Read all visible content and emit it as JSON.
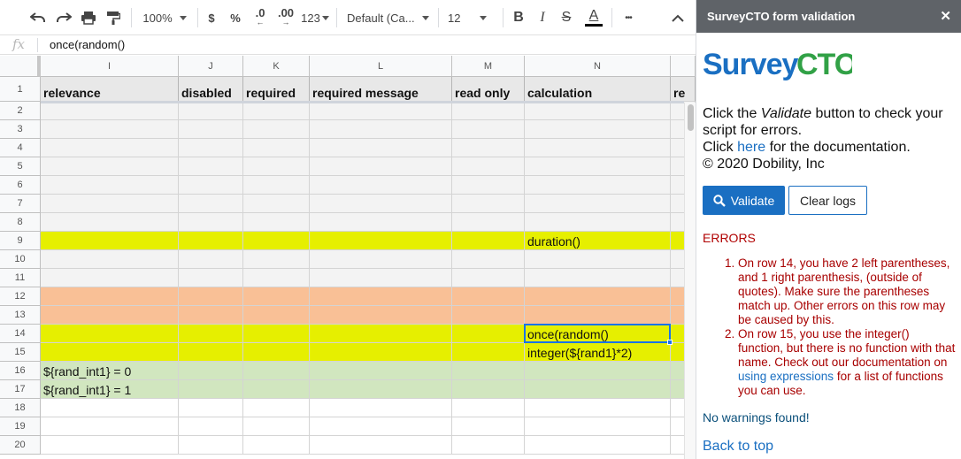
{
  "toolbar": {
    "zoom": "100%",
    "currency": "$",
    "percent": "%",
    "decrease_decimal": ".0",
    "increase_decimal": ".00",
    "number_format": "123",
    "font": "Default (Ca...",
    "font_size": "12",
    "bold": "B",
    "italic": "I",
    "strikethrough": "S",
    "text_color": "A",
    "more": "•••"
  },
  "formula_bar": {
    "fx": "fx",
    "value": "once(random()"
  },
  "columns": [
    {
      "letter": "I",
      "header": "relevance"
    },
    {
      "letter": "J",
      "header": "disabled"
    },
    {
      "letter": "K",
      "header": "required"
    },
    {
      "letter": "L",
      "header": "required message"
    },
    {
      "letter": "M",
      "header": "read only"
    },
    {
      "letter": "N",
      "header": "calculation"
    },
    {
      "letter": "",
      "header": "re"
    }
  ],
  "rows": [
    {
      "num": "2",
      "color": "#f3f3f3",
      "cells": [
        "",
        "",
        "",
        "",
        "",
        "",
        ""
      ]
    },
    {
      "num": "3",
      "color": "#f3f3f3",
      "cells": [
        "",
        "",
        "",
        "",
        "",
        "",
        ""
      ]
    },
    {
      "num": "4",
      "color": "#f3f3f3",
      "cells": [
        "",
        "",
        "",
        "",
        "",
        "",
        ""
      ]
    },
    {
      "num": "5",
      "color": "#f3f3f3",
      "cells": [
        "",
        "",
        "",
        "",
        "",
        "",
        ""
      ]
    },
    {
      "num": "6",
      "color": "#f3f3f3",
      "cells": [
        "",
        "",
        "",
        "",
        "",
        "",
        ""
      ]
    },
    {
      "num": "7",
      "color": "#f3f3f3",
      "cells": [
        "",
        "",
        "",
        "",
        "",
        "",
        ""
      ]
    },
    {
      "num": "8",
      "color": "#f3f3f3",
      "cells": [
        "",
        "",
        "",
        "",
        "",
        "",
        ""
      ]
    },
    {
      "num": "9",
      "color": "#e6ef00",
      "cells": [
        "",
        "",
        "",
        "",
        "",
        "duration()",
        ""
      ]
    },
    {
      "num": "10",
      "color": "#f3f3f3",
      "cells": [
        "",
        "",
        "",
        "",
        "",
        "",
        ""
      ]
    },
    {
      "num": "11",
      "color": "#f3f3f3",
      "cells": [
        "",
        "",
        "",
        "",
        "",
        "",
        ""
      ]
    },
    {
      "num": "12",
      "color": "#f9c096",
      "cells": [
        "",
        "",
        "",
        "",
        "",
        "",
        ""
      ]
    },
    {
      "num": "13",
      "color": "#f9c096",
      "cells": [
        "",
        "",
        "",
        "",
        "",
        "",
        ""
      ]
    },
    {
      "num": "14",
      "color": "#e6ef00",
      "cells": [
        "",
        "",
        "",
        "",
        "",
        "once(random()",
        ""
      ]
    },
    {
      "num": "15",
      "color": "#e6ef00",
      "cells": [
        "",
        "",
        "",
        "",
        "",
        "integer(${rand1}*2)",
        ""
      ]
    },
    {
      "num": "16",
      "color": "#d1e6bf",
      "cells": [
        "${rand_int1} = 0",
        "",
        "",
        "",
        "",
        "",
        ""
      ]
    },
    {
      "num": "17",
      "color": "#d1e6bf",
      "cells": [
        "${rand_int1} = 1",
        "",
        "",
        "",
        "",
        "",
        ""
      ]
    },
    {
      "num": "18",
      "color": "#ffffff",
      "cells": [
        "",
        "",
        "",
        "",
        "",
        "",
        ""
      ]
    },
    {
      "num": "19",
      "color": "#ffffff",
      "cells": [
        "",
        "",
        "",
        "",
        "",
        "",
        ""
      ]
    },
    {
      "num": "20",
      "color": "#ffffff",
      "cells": [
        "",
        "",
        "",
        "",
        "",
        "",
        ""
      ]
    }
  ],
  "header_row_num": "1",
  "panel": {
    "title": "SurveyCTO form validation",
    "close": "✕",
    "logo_survey": "Survey",
    "logo_cto": "CTO",
    "intro_prefix": "Click the ",
    "intro_validate": "Validate",
    "intro_suffix": " button to check your script for errors.",
    "doc_prefix": "Click ",
    "doc_link": "here",
    "doc_suffix": " for the documentation.",
    "copyright": "© 2020 Dobility, Inc",
    "validate_button": "Validate",
    "clear_button": "Clear logs",
    "errors_title": "ERRORS",
    "error_1": "On row 14, you have 2 left parentheses, and 1 right parenthesis, (outside of quotes). Make sure the parentheses match up. Other errors on this row may be caused by this.",
    "error_2_prefix": "On row 15, you use the integer() function, but there is no function with that name. Check out our documentation on ",
    "error_2_link": "using expressions",
    "error_2_suffix": " for a list of functions you can use.",
    "warnings": "No warnings found!",
    "back_to_top": "Back to top"
  }
}
